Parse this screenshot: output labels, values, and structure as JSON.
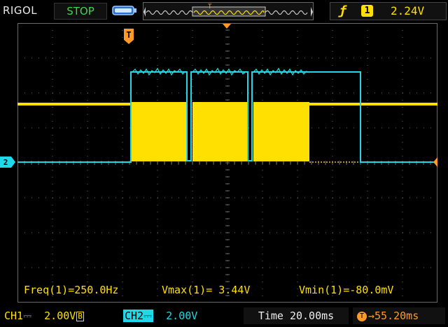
{
  "header": {
    "brand": "RIGOL",
    "run_state": "STOP",
    "trigger": {
      "edge_symbol": "ƒ",
      "source": "1",
      "level": "2.24V"
    }
  },
  "markers": {
    "trigger_position_label": "T",
    "ch2_ground_label": "2"
  },
  "measurements": {
    "freq": "Freq(1)=250.0Hz",
    "vmax": "Vmax(1)= 3.44V",
    "vmin": "Vmin(1)=-80.0mV"
  },
  "footer": {
    "ch1_label": "CH1",
    "ch1_coupling": "⎓",
    "ch1_scale": "2.00V",
    "ch1_bw": "B",
    "ch2_label": "CH2",
    "ch2_coupling": "⎓",
    "ch2_scale": "2.00V",
    "time": "Time 20.00ms",
    "trigger_offset": "55.20ms",
    "trigger_offset_icon": "T"
  },
  "colors": {
    "ch1": "#ffe000",
    "ch2": "#20d8e8",
    "grid": "#6a6a6a",
    "trigger": "#ff9a2a"
  },
  "waveform_data": {
    "ch1": {
      "idle": "high",
      "bursts_of_pwm_count": 3,
      "pwm_frequency": "250.0Hz"
    },
    "ch2": {
      "pulses_count": 3,
      "last_pulse_extends_after_burst": true
    }
  }
}
